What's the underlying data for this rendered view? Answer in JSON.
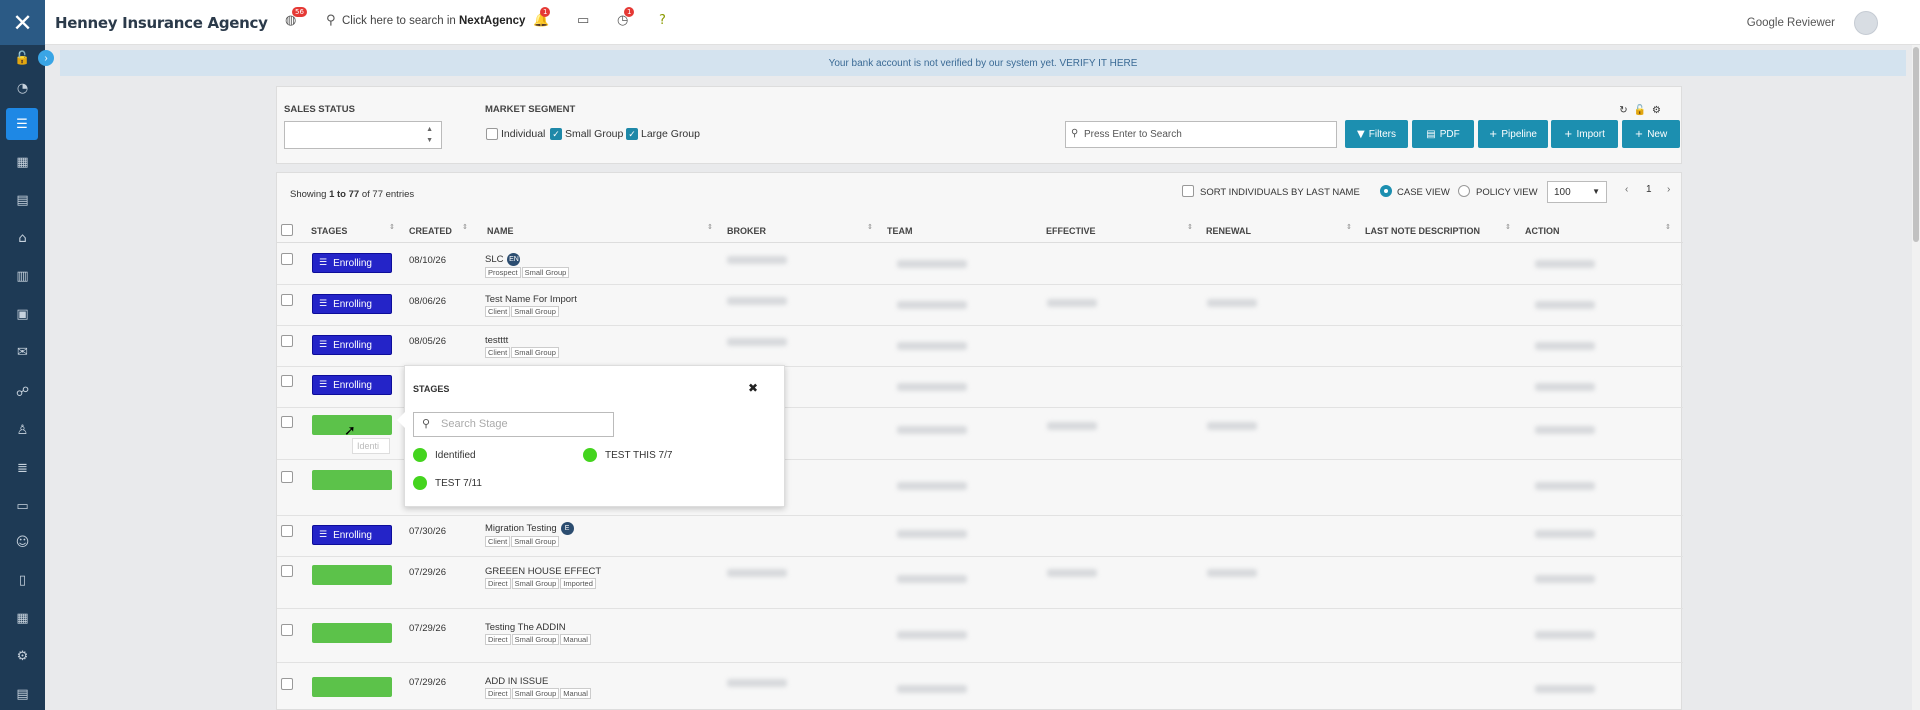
{
  "app": {
    "brand": "Henney Insurance Agency",
    "search_prefix": "Click here to search in ",
    "search_app": "NextAgency",
    "badge_globe": "56",
    "badge_bell": "1",
    "badge_clock": "1",
    "user_name": "Google Reviewer"
  },
  "notice": "Your bank account is not verified by our system yet. VERIFY IT HERE",
  "filters": {
    "sales_status_label": "SALES STATUS",
    "market_segment_label": "MARKET SEGMENT",
    "segments": [
      {
        "label": "Individual",
        "checked": false
      },
      {
        "label": "Small Group",
        "checked": true
      },
      {
        "label": "Large Group",
        "checked": true
      }
    ],
    "search_placeholder": "Press Enter to Search",
    "buttons": {
      "filters": "Filters",
      "pdf": "PDF",
      "pipeline": "Pipeline",
      "import": "Import",
      "new": "New"
    }
  },
  "table": {
    "showing_prefix": "Showing ",
    "showing_range": "1 to 77",
    "showing_suffix": " of 77 entries",
    "sort_individuals": "SORT INDIVIDUALS BY LAST NAME",
    "case_view": "CASE VIEW",
    "policy_view": "POLICY VIEW",
    "per_page": "100",
    "page": "1",
    "columns": [
      "STAGES",
      "CREATED",
      "NAME",
      "BROKER",
      "TEAM",
      "EFFECTIVE",
      "RENEWAL",
      "LAST NOTE DESCRIPTION",
      "ACTION"
    ],
    "rows": [
      {
        "stage": "Enrolling",
        "stage_type": "enroll",
        "created": "08/10/26",
        "name": "SLC",
        "badge": "EN",
        "tags": [
          "Prospect",
          "Small Group"
        ]
      },
      {
        "stage": "Enrolling",
        "stage_type": "enroll",
        "created": "08/06/26",
        "name": "Test Name For Import",
        "badge": "",
        "tags": [
          "Client",
          "Small Group"
        ]
      },
      {
        "stage": "Enrolling",
        "stage_type": "enroll",
        "created": "08/05/26",
        "name": "testttt",
        "badge": "",
        "tags": [
          "Client",
          "Small Group"
        ]
      },
      {
        "stage": "Enrolling",
        "stage_type": "enroll",
        "created": "",
        "name": "",
        "badge": "",
        "tags": []
      },
      {
        "stage": "",
        "stage_type": "green",
        "created": "",
        "name": "",
        "badge": "",
        "tags": []
      },
      {
        "stage": "",
        "stage_type": "green",
        "created": "",
        "name": "",
        "badge": "",
        "tags": []
      },
      {
        "stage": "Enrolling",
        "stage_type": "enroll",
        "created": "07/30/26",
        "name": "Migration Testing",
        "badge": "E",
        "tags": [
          "Client",
          "Small Group"
        ]
      },
      {
        "stage": "",
        "stage_type": "green",
        "created": "07/29/26",
        "name": "GREEEN HOUSE EFFECT",
        "badge": "",
        "tags": [
          "Direct",
          "Small Group",
          "Imported"
        ]
      },
      {
        "stage": "",
        "stage_type": "green",
        "created": "07/29/26",
        "name": "Testing The ADDIN",
        "badge": "",
        "tags": [
          "Direct",
          "Small Group",
          "Manual"
        ]
      },
      {
        "stage": "",
        "stage_type": "green",
        "created": "07/29/26",
        "name": "ADD IN ISSUE",
        "badge": "",
        "tags": [
          "Direct",
          "Small Group",
          "Manual"
        ]
      }
    ]
  },
  "popup": {
    "title": "STAGES",
    "search_placeholder": "Search Stage",
    "options": [
      "Identified",
      "TEST THIS 7/7",
      "TEST 7/11"
    ],
    "tooltip": "Identi"
  },
  "colors": {
    "sidebar": "#1e3a55",
    "accent": "#1c8fb0",
    "enrolling": "#2424c8",
    "stage_green": "#5cc24a",
    "dot_green": "#44d41e"
  }
}
